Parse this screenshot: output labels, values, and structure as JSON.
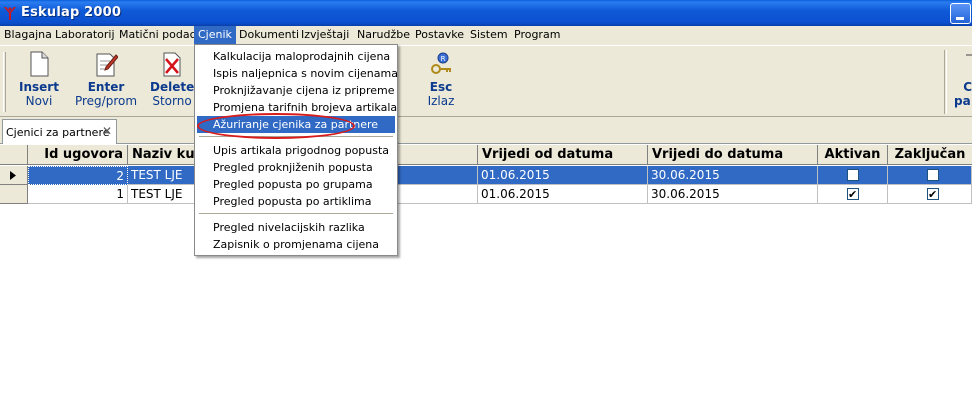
{
  "window": {
    "title": "Eskulap 2000"
  },
  "menu": [
    {
      "label": "Blagajna"
    },
    {
      "label": "Laboratorij"
    },
    {
      "label": "Matični podaci"
    },
    {
      "label": "Cjenik"
    },
    {
      "label": "Dokumenti"
    },
    {
      "label": "Izvještaji"
    },
    {
      "label": "Narudžbe"
    },
    {
      "label": "Postavke"
    },
    {
      "label": "Sistem"
    },
    {
      "label": "Program"
    }
  ],
  "toolbar": {
    "insert": {
      "key": "Insert",
      "label": "Novi"
    },
    "enter": {
      "key": "Enter",
      "label": "Preg/prom"
    },
    "delete": {
      "key": "Delete",
      "label": "Storno"
    },
    "esc": {
      "key": "Esc",
      "label": "Izlaz"
    },
    "right_partial": {
      "key": "C",
      "label": "pa"
    }
  },
  "tab": {
    "label": "Cjenici za partnere"
  },
  "grid": {
    "columns": [
      "Id ugovora",
      "Naziv kup",
      "Vrijedi od datuma",
      "Vrijedi do datuma",
      "Aktivan",
      "Zaključan"
    ],
    "rows": [
      {
        "id": "2",
        "naziv": "TEST LJE",
        "od": "01.06.2015",
        "do": "30.06.2015",
        "aktivan": false,
        "zakljucan": false,
        "selected": true
      },
      {
        "id": "1",
        "naziv": "TEST LJE",
        "od": "01.06.2015",
        "do": "30.06.2015",
        "aktivan": true,
        "zakljucan": true,
        "selected": false
      }
    ]
  },
  "dropdown": {
    "items": [
      {
        "label": "Kalkulacija maloprodajnih cijena"
      },
      {
        "label": "Ispis naljepnica s novim cijenama"
      },
      {
        "label": "Proknjižavanje cijena iz pripreme"
      },
      {
        "label": "Promjena tarifnih brojeva artikala"
      },
      {
        "label": "Ažuriranje cjenika za partnere"
      },
      {
        "label": "Upis artikala prigodnog popusta"
      },
      {
        "label": "Pregled proknjiženih popusta"
      },
      {
        "label": "Pregled popusta po grupama"
      },
      {
        "label": "Pregled popusta po artiklima"
      },
      {
        "label": "Pregled nivelacijskih razlika"
      },
      {
        "label": "Zapisnik o promjenama cijena"
      }
    ]
  },
  "colors": {
    "highlight": "#316ac5",
    "annotation": "#d81b1b",
    "titlebar": "#0b4fcf",
    "chrome": "#ece9d8"
  }
}
